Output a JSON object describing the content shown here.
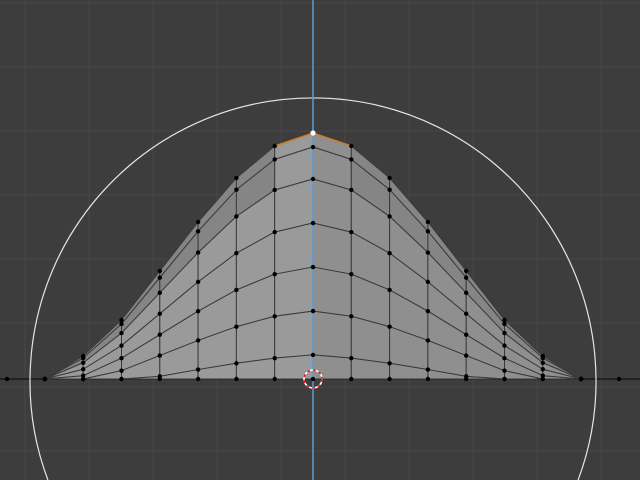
{
  "viewport": {
    "background": "#3d3d3d",
    "grid_color": "#474747",
    "axis_color": "#5a9bd8",
    "mesh_face_front": "#9a9a9a",
    "mesh_face_side": "#858585",
    "edge_color": "#3a3a3a",
    "vertex_color": "#000000",
    "active_vertex_color": "#ffffff",
    "selected_edge_color": "#d27a2a",
    "circle_color": "#e6e6e6",
    "cursor_colors": [
      "#e02020",
      "#ffffff"
    ]
  }
}
